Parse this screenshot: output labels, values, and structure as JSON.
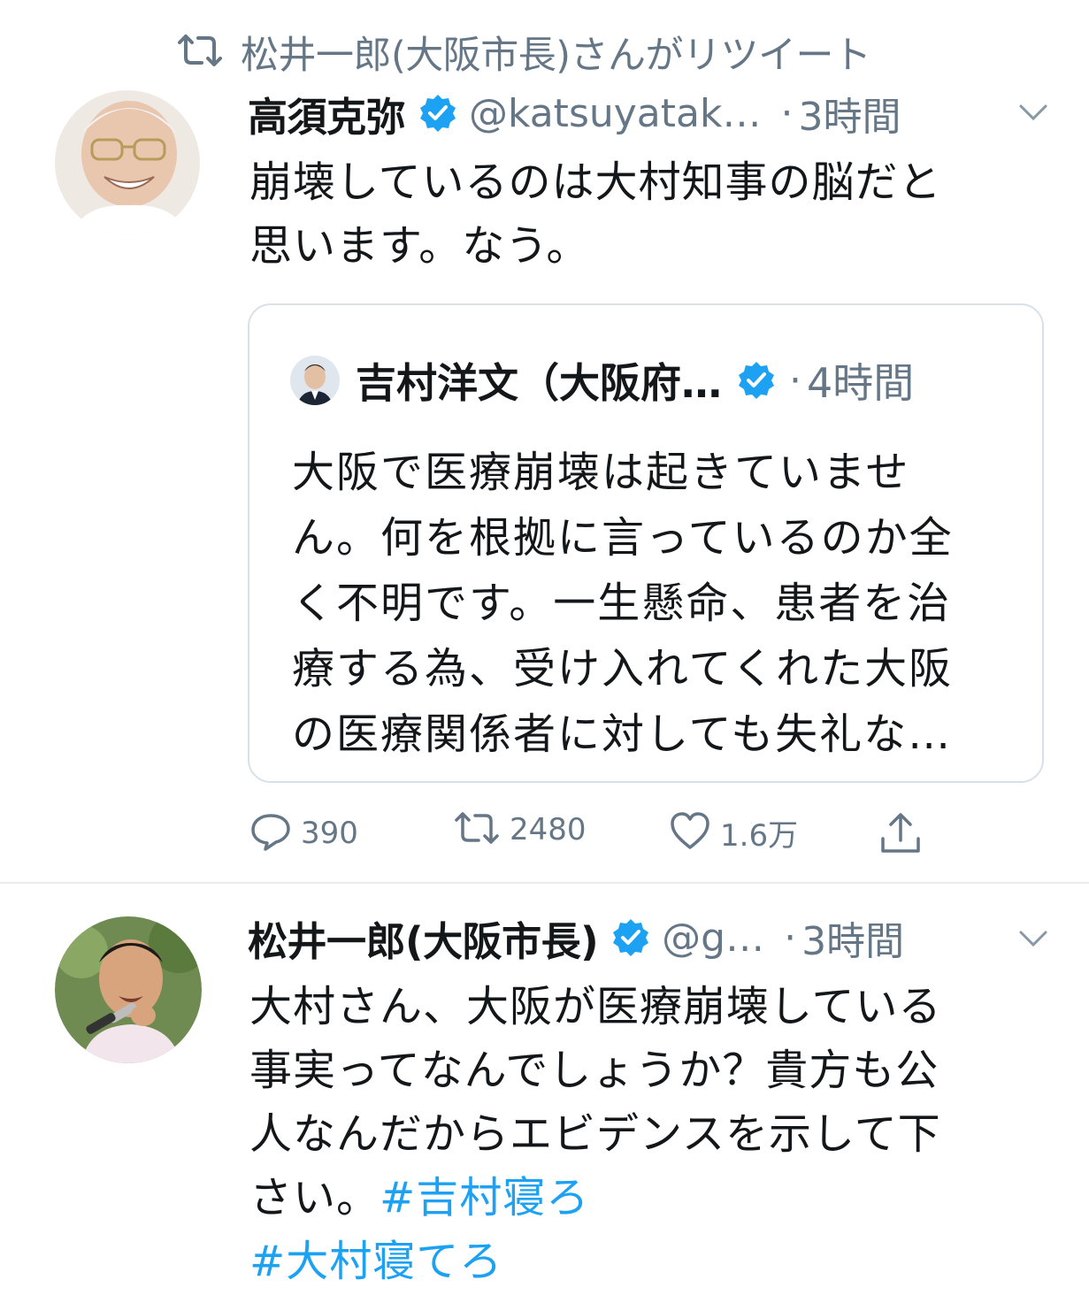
{
  "retweet_header": {
    "icon": "retweet-icon",
    "text": "松井一郎(大阪市長)さんがリツイート"
  },
  "tweet1": {
    "display_name": "高須克弥",
    "handle": "@katsuyatak…",
    "dot": "·",
    "time": "3時間",
    "text_lines": [
      "崩壊しているのは大村知事の脳だと",
      "思います。なう。"
    ],
    "quote": {
      "display_name": "吉村洋文（大阪府…",
      "dot": "·",
      "time": "4時間",
      "text_lines": [
        "大阪で医療崩壊は起きていませ",
        "ん。何を根拠に言っているのか全",
        "く不明です。一生懸命、患者を治",
        "療する為、受け入れてくれた大阪",
        "の医療関係者に対しても失礼な…"
      ]
    },
    "actions": {
      "replies": "390",
      "retweets": "2480",
      "likes": "1.6万"
    }
  },
  "tweet2": {
    "display_name": "松井一郎(大阪市長)",
    "handle": "@g…",
    "dot": "·",
    "time": "3時間",
    "text_lines": [
      "大村さん、大阪が医療崩壊している",
      "事実ってなんでしょうか？貴方も公",
      "人なんだからエビデンスを示して下"
    ],
    "last_line_prefix": "さい。",
    "hashtag1": "#吉村寝ろ",
    "hashtag2": "#大村寝てろ"
  },
  "colors": {
    "accent": "#1da1f2",
    "muted": "#657786",
    "verified": "#1da1f2",
    "border": "#d9e1e8"
  }
}
